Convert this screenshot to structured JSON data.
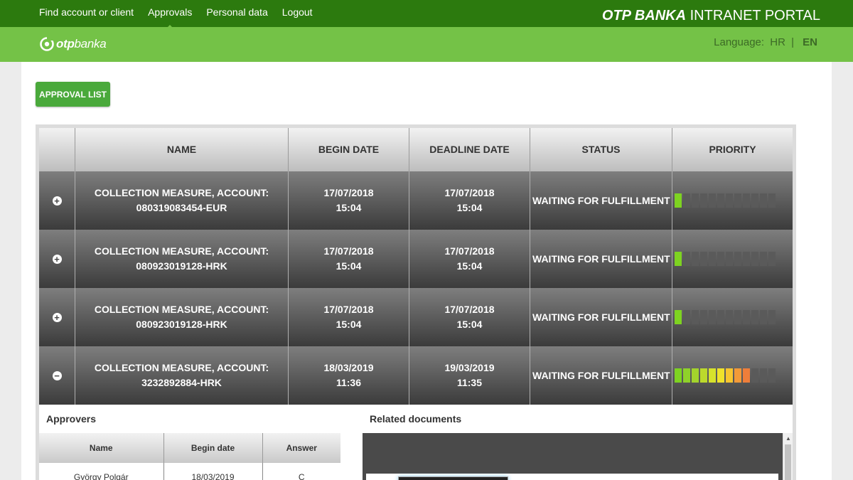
{
  "nav": {
    "items": [
      {
        "label": "Find account or client"
      },
      {
        "label": "Approvals"
      },
      {
        "label": "Personal data"
      },
      {
        "label": "Logout"
      }
    ],
    "active_index": 1
  },
  "portal": {
    "brand": "OTP BANKA",
    "title": "INTRANET PORTAL"
  },
  "logo": {
    "text_bold": "otp",
    "text": "banka"
  },
  "language": {
    "label": "Language:",
    "hr": "HR",
    "separator": "|",
    "en": "EN",
    "selected": "EN"
  },
  "approval_list_button": "APPROVAL LIST",
  "table": {
    "headers": [
      "NAME",
      "BEGIN DATE",
      "DEADLINE DATE",
      "STATUS",
      "PRIORITY"
    ],
    "rows": [
      {
        "expanded": false,
        "toggle": "+",
        "name_line1": "COLLECTION MEASURE, ACCOUNT:",
        "name_line2": "080319083454-EUR",
        "begin_date": "17/07/2018",
        "begin_time": "15:04",
        "deadline_date": "17/07/2018",
        "deadline_time": "15:04",
        "status": "WAITING FOR FULFILLMENT",
        "priority_filled": 1,
        "priority_total": 12
      },
      {
        "expanded": false,
        "toggle": "+",
        "name_line1": "COLLECTION MEASURE, ACCOUNT:",
        "name_line2": "080923019128-HRK",
        "begin_date": "17/07/2018",
        "begin_time": "15:04",
        "deadline_date": "17/07/2018",
        "deadline_time": "15:04",
        "status": "WAITING FOR FULFILLMENT",
        "priority_filled": 1,
        "priority_total": 12
      },
      {
        "expanded": false,
        "toggle": "+",
        "name_line1": "COLLECTION MEASURE, ACCOUNT:",
        "name_line2": "080923019128-HRK",
        "begin_date": "17/07/2018",
        "begin_time": "15:04",
        "deadline_date": "17/07/2018",
        "deadline_time": "15:04",
        "status": "WAITING FOR FULFILLMENT",
        "priority_filled": 1,
        "priority_total": 12
      },
      {
        "expanded": true,
        "toggle": "−",
        "name_line1": "COLLECTION MEASURE, ACCOUNT:",
        "name_line2": "3232892884-HRK",
        "begin_date": "18/03/2019",
        "begin_time": "11:36",
        "deadline_date": "19/03/2019",
        "deadline_time": "11:35",
        "status": "WAITING FOR FULFILLMENT",
        "priority_filled": 9,
        "priority_total": 12
      }
    ],
    "priority_colors": [
      "#7ed321",
      "#8fd12a",
      "#a3d32c",
      "#bcd92c",
      "#d7e22c",
      "#efe22b",
      "#f7c52f",
      "#f39a38",
      "#ee7e3a",
      "#e8643a",
      "#e14b3a",
      "#d6353a"
    ],
    "priority_empty_color": "#5a5a5a"
  },
  "approvers": {
    "title": "Approvers",
    "headers": [
      "Name",
      "Begin date",
      "Answer"
    ],
    "rows": [
      {
        "name": "György Polgár",
        "begin_date": "18/03/2019",
        "answer": "C"
      }
    ]
  },
  "documents": {
    "title": "Related documents"
  }
}
